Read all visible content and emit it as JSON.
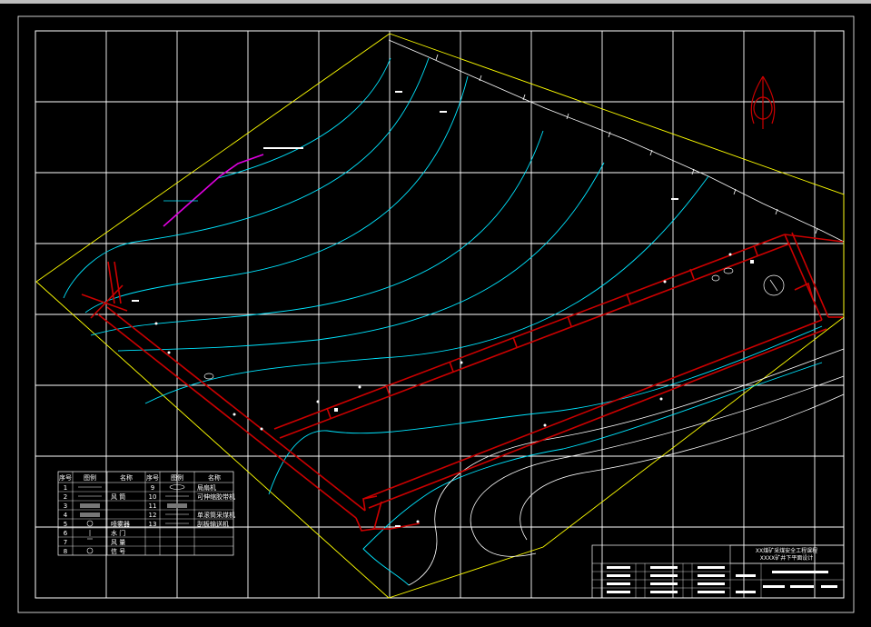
{
  "legend": {
    "headers": [
      "序号",
      "图例",
      "名称",
      "序号",
      "图例",
      "名称"
    ],
    "rows": [
      {
        "no": "1",
        "name": "",
        "no2": "9",
        "name2": "局扇机"
      },
      {
        "no": "2",
        "name": "风 筒",
        "no2": "10",
        "name2": "可伸缩胶带机"
      },
      {
        "no": "3",
        "name": "",
        "no2": "11",
        "name2": ""
      },
      {
        "no": "4",
        "name": "",
        "no2": "12",
        "name2": "单滚筒采煤机"
      },
      {
        "no": "5",
        "name": "喷雾器",
        "no2": "13",
        "name2": "刮板输送机"
      },
      {
        "no": "6",
        "name": "水 门",
        "no2": "",
        "name2": ""
      },
      {
        "no": "7",
        "name": "风 量",
        "no2": "",
        "name2": ""
      },
      {
        "no": "8",
        "name": "信 号",
        "no2": "",
        "name2": ""
      }
    ]
  },
  "title_block": {
    "line1": "XX煤矿采煤安全工程课程",
    "line2": "XXXX矿井下平面设计"
  },
  "colors": {
    "background": "#000000",
    "grid": "#ffffff",
    "boundary": "#ffff00",
    "contour": "#00e5ff",
    "roadway": "#cc0000",
    "marker": "#e000e0"
  },
  "icons": {
    "north_arrow": "north-arrow-icon",
    "equipment": "equipment-symbol-icon"
  }
}
